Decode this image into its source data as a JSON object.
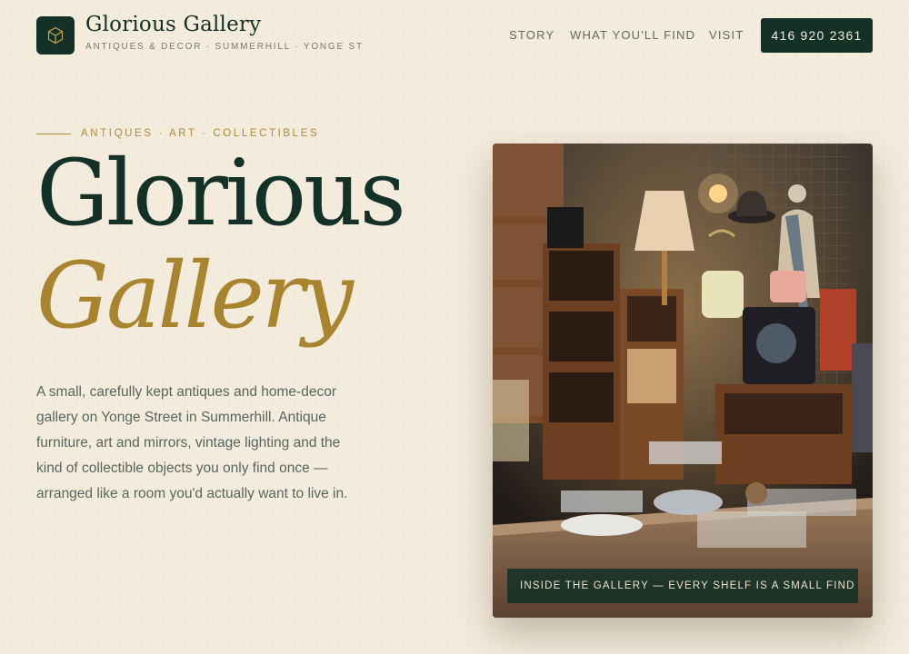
{
  "header": {
    "logo_icon": "geometric-cube-logo-icon",
    "brand_name": "Glorious Gallery",
    "brand_tagline": "ANTIQUES & DECOR · SUMMERHILL · YONGE ST",
    "nav": [
      {
        "label": "STORY"
      },
      {
        "label": "WHAT YOU'LL FIND"
      },
      {
        "label": "VISIT"
      }
    ],
    "phone": "416 920 2361"
  },
  "hero": {
    "eyebrow": "ANTIQUES · ART · COLLECTIBLES",
    "title_line1": "Glorious",
    "title_line2": "Gallery",
    "intro": "A small, carefully kept antiques and home-decor gallery on Yonge Street in Summerhill. Antique furniture, art and mirrors, vintage lighting and the kind of collectible objects you only find once — arranged like a room you'd actually want to live in.",
    "photo_caption": "INSIDE THE GALLERY — EVERY SHELF IS A SMALL FIND"
  },
  "colors": {
    "background": "#f3ebdb",
    "primary_green": "#143127",
    "accent_gold": "#b08a3a",
    "body_text": "#586660"
  }
}
